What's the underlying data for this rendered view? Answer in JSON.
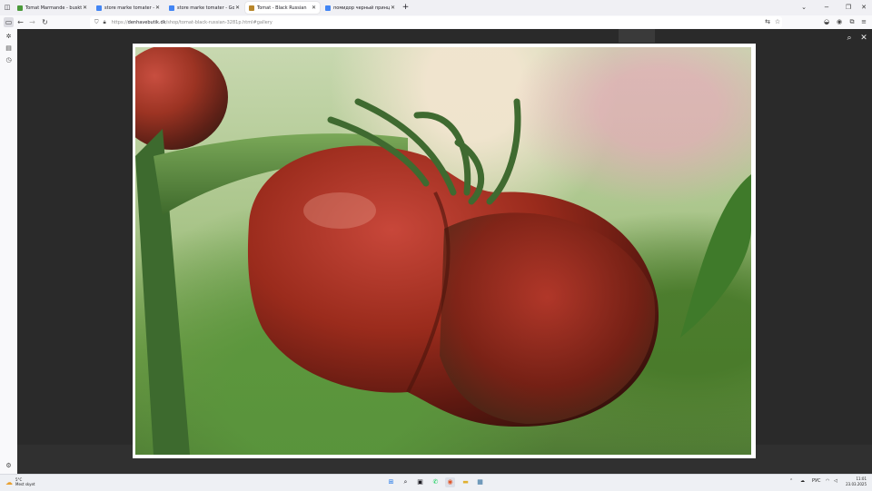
{
  "tabs": [
    {
      "label": "Tomat Marmande - busktomat | ",
      "icon": "leaf-icon",
      "color": "#4a9a3a",
      "active": false
    },
    {
      "label": "store marke tomater - Google - ",
      "icon": "google-icon",
      "color": "#4285f4",
      "active": false
    },
    {
      "label": "store marke tomater - Google - ",
      "icon": "google-icon",
      "color": "#4285f4",
      "active": false
    },
    {
      "label": "Tomat - Black Russian",
      "icon": "shop-icon",
      "color": "#b8862b",
      "active": true
    },
    {
      "label": "помидор черный принц фото",
      "icon": "google-icon",
      "color": "#4285f4",
      "active": false
    }
  ],
  "newtab": "+",
  "window": {
    "minimize": "⌄",
    "min": "−",
    "restore": "❐",
    "close": "✕"
  },
  "nav": {
    "back": "←",
    "forward": "→",
    "reload": "↻"
  },
  "url": {
    "prefix": "https://",
    "host": "denhavebutik.dk",
    "path": "/shop/tomat-black-russian-3281p.html#gallery"
  },
  "nav_right": [
    "translate-icon",
    "star-icon",
    "pocket-icon",
    "account-icon",
    "extensions-icon",
    "menu-icon"
  ],
  "sidebar": [
    "sidebar-toggle-icon",
    "ai-chat-icon",
    "bookmarks-icon",
    "history-icon",
    "settings-icon"
  ],
  "viewer": {
    "zoom": "⌕",
    "close": "✕"
  },
  "taskbar": {
    "temp": "5°C",
    "condition": "Mest skyet",
    "apps": [
      "windows-start-icon",
      "search-icon",
      "task-view-icon",
      "whatsapp-icon",
      "firefox-icon",
      "file-explorer-icon",
      "app-icon"
    ],
    "lang": "РУС",
    "time": "11:01",
    "date": "23.03.2025"
  },
  "colors": {
    "viewer_bg": "#2a2a2a",
    "tomato": "#8a2418",
    "stem": "#4f7e3a"
  }
}
